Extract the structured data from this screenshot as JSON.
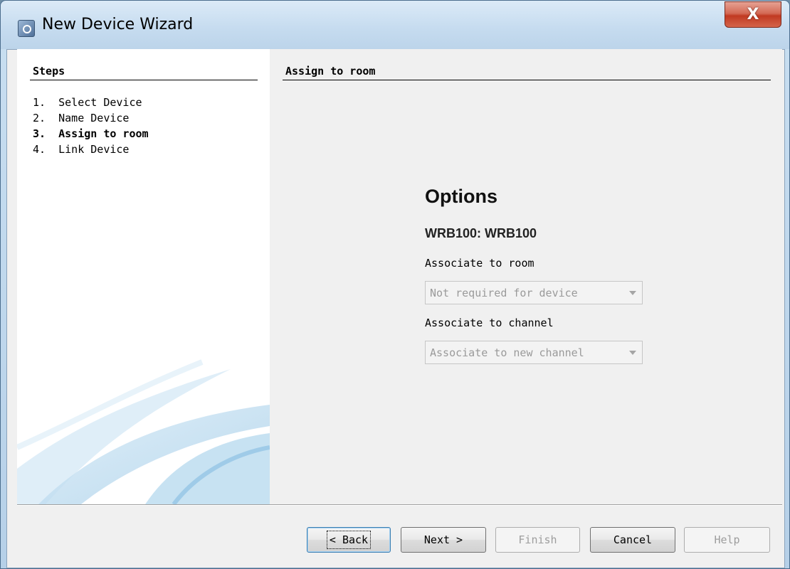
{
  "window": {
    "title": "New Device Wizard",
    "close_glyph": "X"
  },
  "steps": {
    "title": "Steps",
    "items": [
      {
        "number": "1.",
        "label": "Select Device"
      },
      {
        "number": "2.",
        "label": "Name Device"
      },
      {
        "number": "3.",
        "label": "Assign to room"
      },
      {
        "number": "4.",
        "label": "Link Device"
      }
    ],
    "active_index": 2
  },
  "panel": {
    "title": "Assign to room",
    "options_heading": "Options",
    "device_name": "WRB100: WRB100",
    "room_label": "Associate to room",
    "room_value": "Not required for device",
    "channel_label": "Associate to channel",
    "channel_value": "Associate to new channel"
  },
  "buttons": {
    "back": "< Back",
    "next": "Next >",
    "finish": "Finish",
    "cancel": "Cancel",
    "help": "Help"
  },
  "icons": {
    "app": "wizard-app-icon",
    "close": "close-icon",
    "dropdown": "chevron-down-icon"
  }
}
